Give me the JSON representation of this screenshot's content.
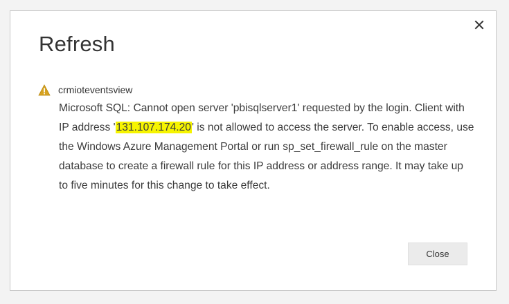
{
  "dialog": {
    "title": "Refresh",
    "close_icon": "close-icon",
    "source_icon": "warning-icon",
    "source_name": "crmioteventsview",
    "message_before_ip": "Microsoft SQL: Cannot open server 'pbisqlserver1' requested by the login. Client with IP address '",
    "ip_address": "131.107.174.20",
    "message_after_ip": "' is not allowed to access the server. To enable access, use the Windows Azure Management Portal or run sp_set_firewall_rule on the master database to create a firewall rule for this IP address or address range. It may take up to five minutes for this change to take effect.",
    "close_button_label": "Close"
  },
  "colors": {
    "warning": "#d7a321",
    "highlight": "#f6f400",
    "text": "#3b3b3b"
  }
}
